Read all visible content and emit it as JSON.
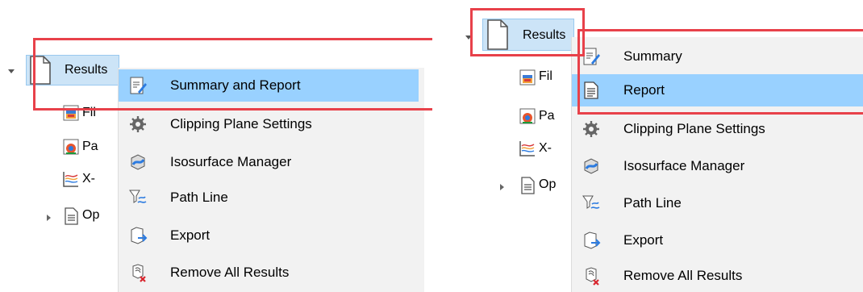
{
  "colors": {
    "callout": "#e8414a",
    "menu_highlight": "#99d1ff",
    "tree_highlight": "#cce4f7",
    "menu_bg": "#f2f2f2"
  },
  "left": {
    "tree": {
      "results_label": "Results",
      "child_labels": [
        "Fil",
        "Pa",
        "X-",
        "Op"
      ],
      "child_icons": [
        "fill-plot-icon",
        "particle-plot-icon",
        "xy-plot-icon",
        "document-icon"
      ]
    },
    "menu": {
      "items": [
        {
          "label": "Summary and Report",
          "icon": "summary-report-icon",
          "highlighted": true
        },
        {
          "label": "Clipping Plane Settings",
          "icon": "clipping-gear-icon"
        },
        {
          "label": "Isosurface Manager",
          "icon": "isosurface-icon"
        },
        {
          "label": "Path Line",
          "icon": "path-line-icon"
        },
        {
          "label": "Export",
          "icon": "export-icon"
        },
        {
          "label": "Remove All Results",
          "icon": "remove-all-icon"
        }
      ]
    }
  },
  "right": {
    "tree": {
      "results_label": "Results",
      "child_labels": [
        "Fil",
        "Pa",
        "X-",
        "Op"
      ],
      "child_icons": [
        "fill-plot-icon",
        "particle-plot-icon",
        "xy-plot-icon",
        "document-icon"
      ]
    },
    "menu": {
      "items": [
        {
          "label": "Summary",
          "icon": "summary-icon"
        },
        {
          "label": "Report",
          "icon": "report-icon",
          "highlighted": true
        },
        {
          "label": "Clipping Plane Settings",
          "icon": "clipping-gear-icon"
        },
        {
          "label": "Isosurface Manager",
          "icon": "isosurface-icon"
        },
        {
          "label": "Path Line",
          "icon": "path-line-icon"
        },
        {
          "label": "Export",
          "icon": "export-icon"
        },
        {
          "label": "Remove All Results",
          "icon": "remove-all-icon"
        }
      ]
    }
  }
}
